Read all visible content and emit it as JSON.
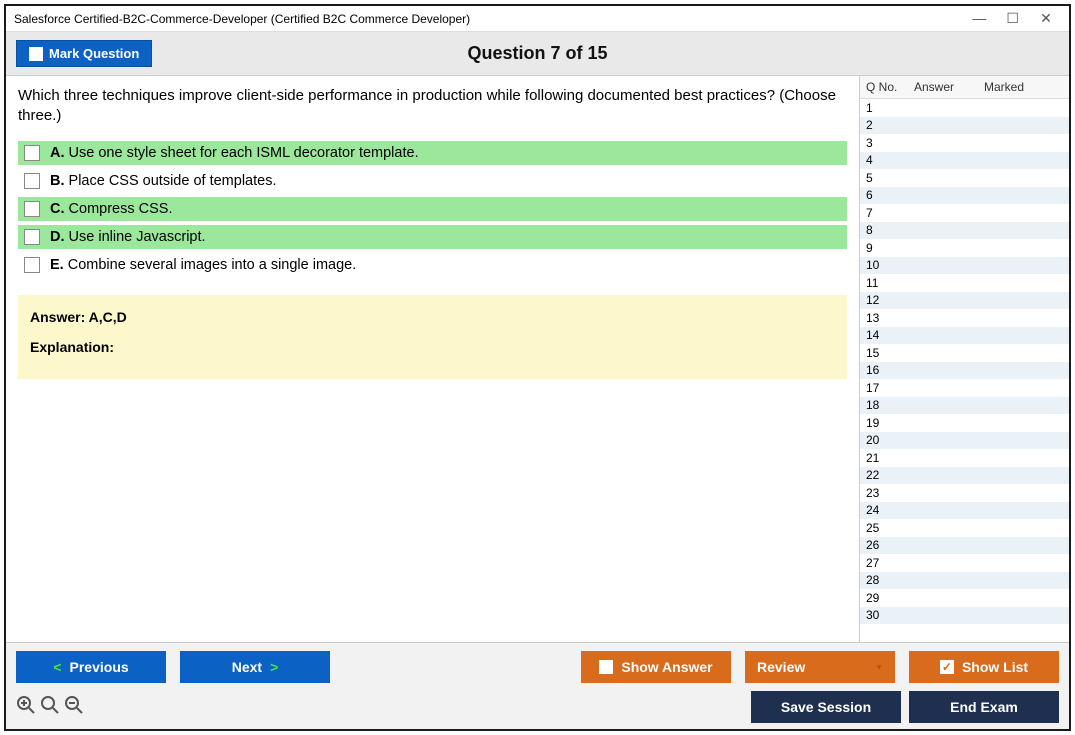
{
  "window": {
    "title": "Salesforce Certified-B2C-Commerce-Developer (Certified B2C Commerce Developer)"
  },
  "topbar": {
    "mark_question": "Mark Question",
    "counter": "Question 7 of 15"
  },
  "question": {
    "text": "Which three techniques improve client-side performance in production while following documented best practices? (Choose three.)",
    "options": [
      {
        "letter": "A.",
        "text": "Use one style sheet for each ISML decorator template.",
        "highlight": true
      },
      {
        "letter": "B.",
        "text": "Place CSS outside of templates.",
        "highlight": false
      },
      {
        "letter": "C.",
        "text": "Compress CSS.",
        "highlight": true
      },
      {
        "letter": "D.",
        "text": "Use inline Javascript.",
        "highlight": true
      },
      {
        "letter": "E.",
        "text": "Combine several images into a single image.",
        "highlight": false
      }
    ],
    "answer_line": "Answer: A,C,D",
    "explanation_label": "Explanation:"
  },
  "sidebar": {
    "headers": {
      "qno": "Q No.",
      "answer": "Answer",
      "marked": "Marked"
    },
    "rows": [
      {
        "n": "1"
      },
      {
        "n": "2"
      },
      {
        "n": "3"
      },
      {
        "n": "4"
      },
      {
        "n": "5"
      },
      {
        "n": "6"
      },
      {
        "n": "7"
      },
      {
        "n": "8"
      },
      {
        "n": "9"
      },
      {
        "n": "10"
      },
      {
        "n": "11"
      },
      {
        "n": "12"
      },
      {
        "n": "13"
      },
      {
        "n": "14"
      },
      {
        "n": "15"
      },
      {
        "n": "16"
      },
      {
        "n": "17"
      },
      {
        "n": "18"
      },
      {
        "n": "19"
      },
      {
        "n": "20"
      },
      {
        "n": "21"
      },
      {
        "n": "22"
      },
      {
        "n": "23"
      },
      {
        "n": "24"
      },
      {
        "n": "25"
      },
      {
        "n": "26"
      },
      {
        "n": "27"
      },
      {
        "n": "28"
      },
      {
        "n": "29"
      },
      {
        "n": "30"
      }
    ]
  },
  "footer": {
    "previous": "Previous",
    "next": "Next",
    "show_answer": "Show Answer",
    "review": "Review",
    "show_list": "Show List",
    "save_session": "Save Session",
    "end_exam": "End Exam"
  }
}
